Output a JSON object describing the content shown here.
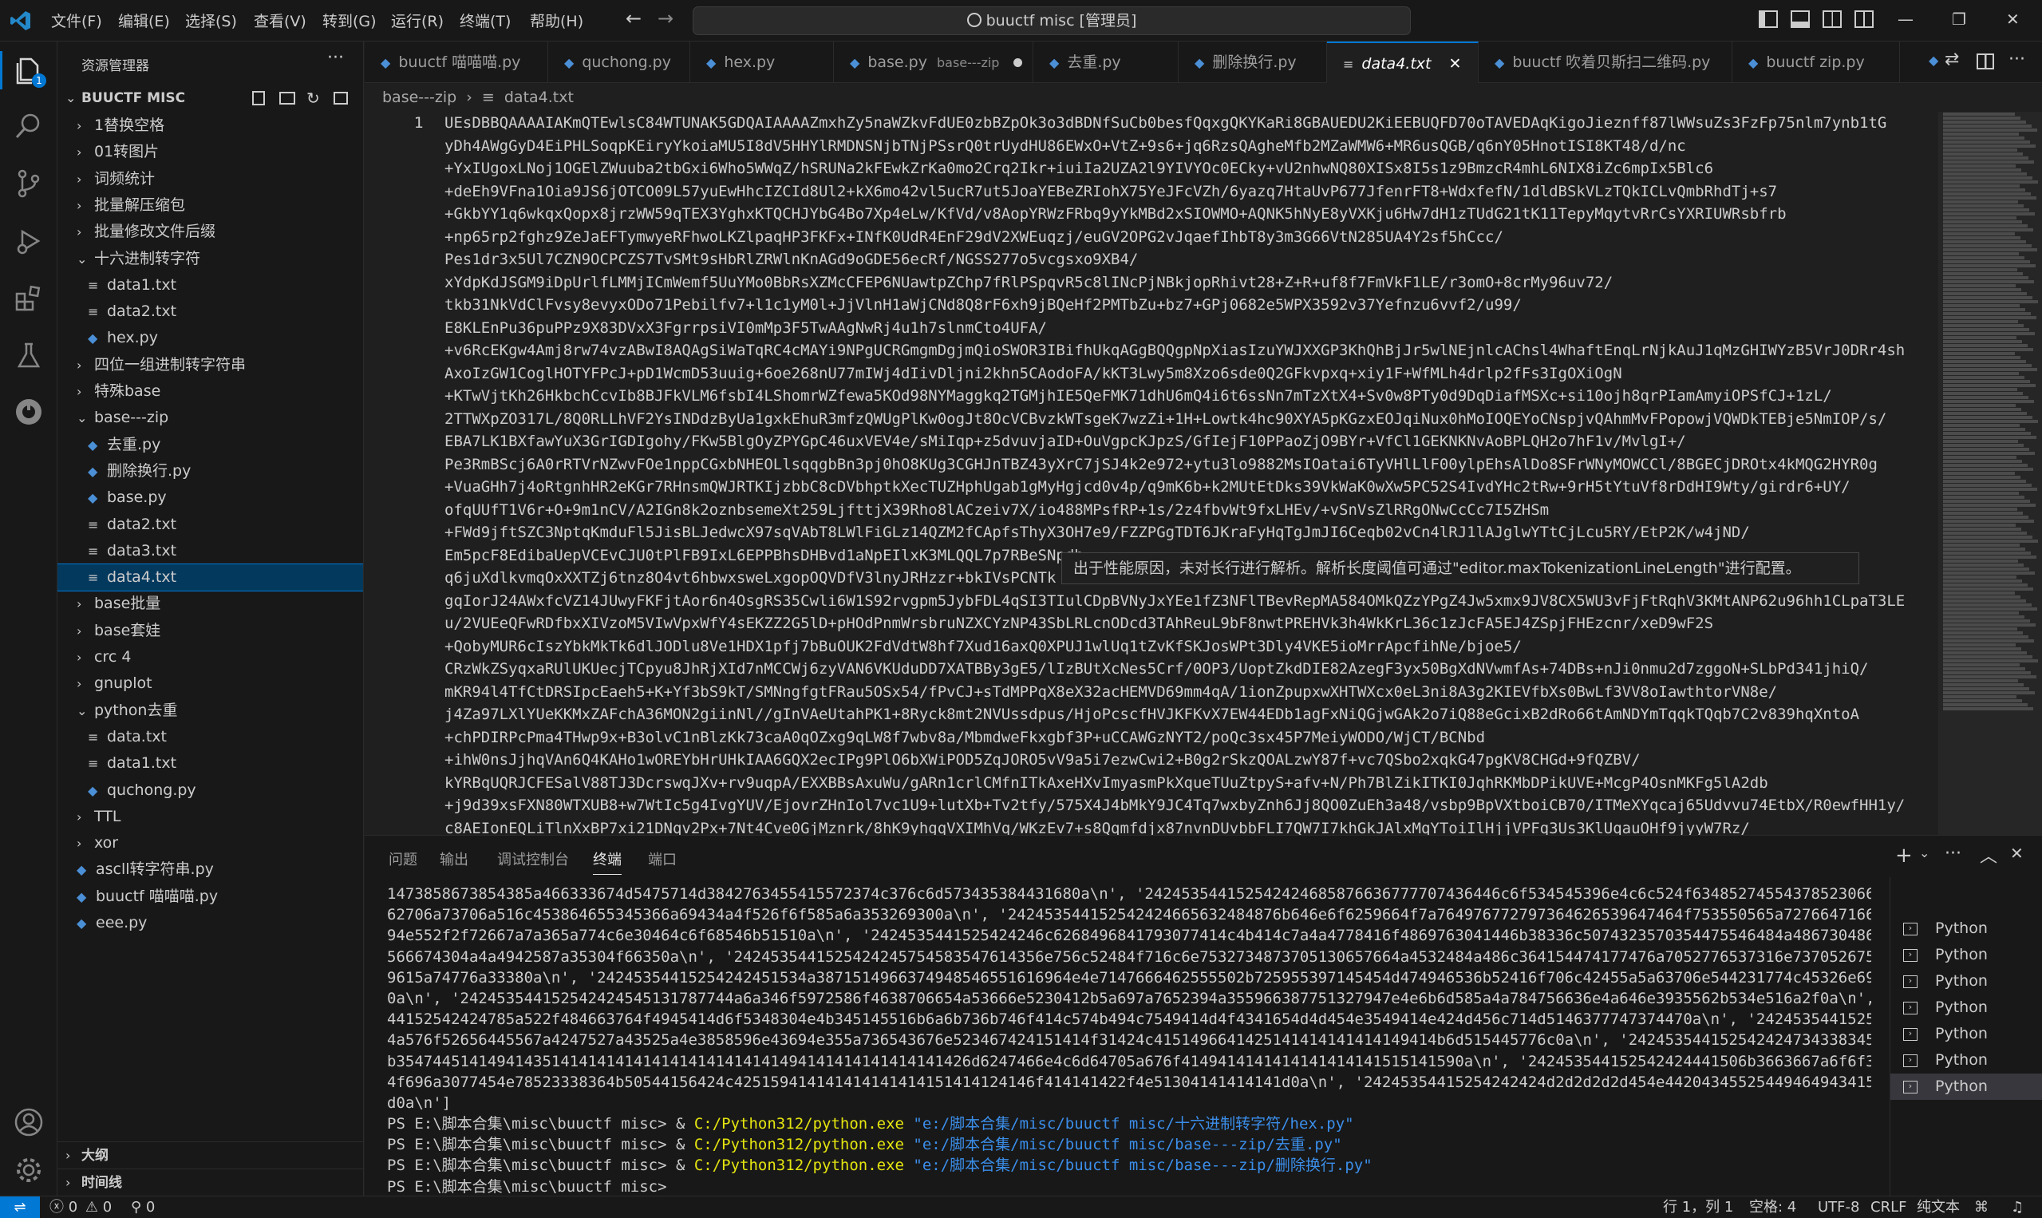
{
  "titlebar": {
    "menu": [
      "文件(F)",
      "编辑(E)",
      "选择(S)",
      "查看(V)",
      "转到(G)",
      "运行(R)",
      "终端(T)",
      "帮助(H)"
    ],
    "search_text": "buuctf misc [管理员]"
  },
  "sidebar": {
    "header": "资源管理器",
    "root": "BUUCTF MISC",
    "items": [
      {
        "label": "1替换空格",
        "kind": "folder",
        "expanded": false,
        "depth": 1
      },
      {
        "label": "01转图片",
        "kind": "folder",
        "expanded": false,
        "depth": 1
      },
      {
        "label": "词频统计",
        "kind": "folder",
        "expanded": false,
        "depth": 1
      },
      {
        "label": "批量解压缩包",
        "kind": "folder",
        "expanded": false,
        "depth": 1
      },
      {
        "label": "批量修改文件后缀",
        "kind": "folder",
        "expanded": false,
        "depth": 1
      },
      {
        "label": "十六进制转字符",
        "kind": "folder",
        "expanded": true,
        "depth": 1
      },
      {
        "label": "data1.txt",
        "kind": "txt",
        "depth": 2
      },
      {
        "label": "data2.txt",
        "kind": "txt",
        "depth": 2
      },
      {
        "label": "hex.py",
        "kind": "py",
        "depth": 2
      },
      {
        "label": "四位一组进制转字符串",
        "kind": "folder",
        "expanded": false,
        "depth": 1
      },
      {
        "label": "特殊base",
        "kind": "folder",
        "expanded": false,
        "depth": 1
      },
      {
        "label": "base---zip",
        "kind": "folder",
        "expanded": true,
        "depth": 1
      },
      {
        "label": "去重.py",
        "kind": "py",
        "depth": 2
      },
      {
        "label": "删除换行.py",
        "kind": "py",
        "depth": 2
      },
      {
        "label": "base.py",
        "kind": "py",
        "depth": 2
      },
      {
        "label": "data2.txt",
        "kind": "txt",
        "depth": 2
      },
      {
        "label": "data3.txt",
        "kind": "txt",
        "depth": 2
      },
      {
        "label": "data4.txt",
        "kind": "txt",
        "depth": 2,
        "selected": true
      },
      {
        "label": "base批量",
        "kind": "folder",
        "expanded": false,
        "depth": 1
      },
      {
        "label": "base套娃",
        "kind": "folder",
        "expanded": false,
        "depth": 1
      },
      {
        "label": "crc 4",
        "kind": "folder",
        "expanded": false,
        "depth": 1
      },
      {
        "label": "gnuplot",
        "kind": "folder",
        "expanded": false,
        "depth": 1
      },
      {
        "label": "python去重",
        "kind": "folder",
        "expanded": true,
        "depth": 1
      },
      {
        "label": "data.txt",
        "kind": "txt",
        "depth": 2
      },
      {
        "label": "data1.txt",
        "kind": "txt",
        "depth": 2
      },
      {
        "label": "quchong.py",
        "kind": "py",
        "depth": 2
      },
      {
        "label": "TTL",
        "kind": "folder",
        "expanded": false,
        "depth": 1
      },
      {
        "label": "xor",
        "kind": "folder",
        "expanded": false,
        "depth": 1
      },
      {
        "label": "ascll转字符串.py",
        "kind": "py",
        "depth": 1
      },
      {
        "label": "buuctf 喵喵喵.py",
        "kind": "py",
        "depth": 1
      },
      {
        "label": "eee.py",
        "kind": "py",
        "depth": 1
      }
    ],
    "outline": "大纲",
    "timeline": "时间线"
  },
  "tabs": [
    {
      "label": "buuctf 喵喵喵.py"
    },
    {
      "label": "quchong.py"
    },
    {
      "label": "hex.py"
    },
    {
      "label": "base.py",
      "desc": "base---zip",
      "dirty": true
    },
    {
      "label": "去重.py"
    },
    {
      "label": "删除换行.py"
    },
    {
      "label": "data4.txt",
      "active": true
    },
    {
      "label": "buuctf 吹着贝斯扫二维码.py"
    },
    {
      "label": "buuctf zip.py"
    }
  ],
  "breadcrumb": {
    "folder": "base---zip",
    "file": "data4.txt"
  },
  "editor": {
    "line_number": "1",
    "lines": [
      "UEsDBBQAAAAIAKmQTEwlsC84WTUNAK5GDQAIAAAAZmxhZy5naWZkvFdUE0zbBZpOk3o3dBDNfSuCb0besfQqxgQKYKaRi8GBAUEDU2KiEEBUQFD70oTAVEDAqKigoJieznff87lWWsuZs3FzFp75nlm7ynb1tG",
      "yDh4AWgGyD4EiPHLSoqpKEiryYkoiaMU5I8dV5HHYlRMDNSNjbTNjPSsrQ0trUydHU86EWxO+VtZ+9s6+jq6RzsQAgheMfb2MZaWMW6+MR6usQGB/q6nY05HnotISI8KT48/d/nc",
      "+YxIUgoxLNoj1OGElZWuuba2tbGxi6Who5WWqZ/hSRUNa2kFEwkZrKa0mo2Crq2Ikr+iuiIa2UZA2l9YIVYOc0ECky+vU2nhwNQ80XISx8I5s1z9BmzcR4mhL6NIX8iZc6mpIx5Blc6",
      "+deEh9VFna1Oia9JS6jOTCO09L57yuEwHhcIZCId8Ul2+kX6mo42vl5ucR7ut5JoaYEBeZRIohX75YeJFcVZh/6yazq7HtaUvP677JfenrFT8+WdxfefN/1dldBSkVLzTQkICLvQmbRhdTj+s7",
      "+GkbYY1q6wkqxQopx8jrzWW59qTEX3YghxKTQCHJYbG4Bo7Xp4eLw/KfVd/v8AopYRWzFRbq9yYkMBd2xSIOWMO+AQNK5hNyE8yVXKju6Hw7dH1zTUdG21tK11TepyMqytvRrCsYXRIUWRsbfrb",
      "+np65rp2fghz9ZeJaEFTymwyeRFhwoLKZlpaqHP3FKFx+INfK0UdR4EnF29dV2XWEuqzj/euGV2OPG2vJqaefIhbT8y3m3G66VtN285UA4Y2sf5hCcc/",
      "Pes1dr3x5Ul7CZN9OCPCZS7TvSMt9sHbRlZRWlnKnAGd9oGDE56ecRf/NGSS277o5vcgsxo9XB4/",
      "xYdpKdJSGM9iDpUrlfLMMjICmWemf5UuYMo0BbRsXZMcCFEP6NUawtpZChp7fRlPSpqvR5c8lINcPjNBkjopRhivt28+Z+R+uf8f7FmVkF1LE/r3omO+8crMy96uv72/",
      "tkb31NkVdClFvsy8evyxODo71Pebilfv7+l1c1yM0l+JjVlnH1aWjCNd8Q8rF6xh9jBQeHf2PMTbZu+bz7+GPj0682e5WPX3592v37Yefnzu6vvf2/u99/",
      "E8KLEnPu36puPPz9X83DVxX3FgrrpsiVI0mMp3F5TwAAgNwRj4u1h7slnmCto4UFA/",
      "+v6RcEKgw4Amj8rw74vzABwI8AQAgSiWaTqRC4cMAYi9NPgUCRGmgmDgjmQioSWOR3IBifhUkqAGgBQQgpNpXiasIzuYWJXXGP3KhQhBjJr5wlNEjnlcAChsl4WhaftEnqLrNjkAuJ1qMzGHIWYzB5VrJ0DRr4sh",
      "AxoIzGW1CoglHOTYFPcJ+pD1WcmD53uuig+6oe268nU77mIWj4dIivDljni2khn5CAodoFA/kKT3Lwy5m8Xzo6sde0Q2GFkvpxq+xiy1F+WfMLh4drlp2fFs3IgOXiOgN",
      "+KTwVjtKh26HkbchCcvIb8BJFkVLM6fsbI4LShomrWZfewa5KOd98NYMaggkq2TGMjhIE5QeFMK71dhU6mQ4i6t6ssNn7mTzXtX4+Sv0w8PTy0d9DqDiafMSXc+si10ojh8qrPIamAmyiOPSfCJ+1zL/",
      "2TTWXpZO317L/8Q0RLLhVF2YsINDdzByUa1gxkEhuR3mfzQWUgPlKw0ogJt8OcVCBvzkWTsgeK7wzZi+1H+Lowtk4hc90XYA5pKGzxEOJqiNux0hMoIOQEYoCNspjvQAhmMvFPopowjVQWDkTEBje5NmIOP/s/",
      "EBA7LK1BXfawYuX3GrIGDIgohy/FKw5BlgOyZPYGpC46uxVEV4e/sMiIqp+z5dvuvjaID+OuVgpcKJpzS/GfIejF10PPaoZjO9BYr+VfCl1GEKNKNvAoBPLQH2o7hF1v/MvlgI+/",
      "Pe3RmBScj6A0rRTVrNZwvFOe1nppCGxbNHEOLlsqqgbBn3pj0hO8KUg3CGHJnTBZ43yXrC7jSJ4k2e972+ytu3lo9882MsIOatai6TyVHlLlF00ylpEhsAlDo8SFrWNyMOWCCl/8BGECjDROtx4kMQG2HYR0g",
      "+VuaGHh7j4oRtgnhHR2eKGr7RHnsmQWJRTKIjzbbC8cDVbhptkXecTUZHphUgab1gMyHgjcd0v4p/q9mK6b+k2MUtEtDks39VkWaK0wXw5PC52S4IvdYHc2tRw+9rH5tYtuVf8rDdHI9Wty/girdr6+UY/",
      "ofqUUfT1V6r+O+9m1nCV/A2IGn8k2oznbsemeXt259LjfttjX39Rho8lACzeiv7X/io488MPsfRP+1s/2z4fbvWt9fxLHEv/+vSnVsZlRRgONwCcCc7I5ZHSm",
      "+FWd9jftSZC3NptqKmduFl5JisBLJedwcX97sqVAbT8LWlFiGLz14QZM2fCApfsThyX3OH7e9/FZZPGgTDT6JKraFyHqTgJmJI6Ceqb02vCn4lRJ1lAJglwYTtCjLcu5RY/EtP2K/w4jND/",
      "Em5pcF8EdibaUepVCEvCJU0tPlFB9IxL6EPPBhsDHBvd1aNpEIlxK3MLQQL7p7RBeSNpdh==============================",
      "q6juXdlkvmqOxXXTZj6tnz8O4vt6hbwxsweLxgopOQVDfV3lnyJRHzzr+bkIVsPCNTk",
      "gqIorJ24AWxfcVZ14JUwyFKFjtAor6n4OsgRS35Cwli6W1S92rvgpm5JybFDL4qSI3TIulCDpBVNyJxYEe1fZ3NFlTBevRepMA584OMkQZzYPgZ4Jw5xmx9JV8CX5WU3vFjFtRqhV3KMtANP62u96hh1CLpaT3LE",
      "u/2VUEeQFwRDfbxXIVzoM5VIwVpxWfY4sEKZZ2G5lD+pHOdPnmWrsbruNZXCYzNP43SbLRLcnODcd3TAhReuL9bF8nwtPREHVk3h4WkKrL36c1zJcFA5EJ4ZSpjFHEzcnr/xeD9wF2S",
      "+QobyMUR6cIszYbkMkTk6dlJODlu8Ve1HDX1pfj7bBuOUK2FdVdtW8hf7Xud16axQ0XPUJ1wlUq1tZvKfSKJosWPt3Dly4VKE5ioMrrApcfihNe/bjoe5/",
      "CRzWkZSyqxaRUlUKUecjTCpyu8JhRjXId7nMCCWj6zyVAN6VKUduDD7XATBBy3gE5/lIzBUtXcNes5Crf/0OP3/UoptZkdDIE82AzegF3yx50BgXdNVwmfAs+74DBs+nJi0nmu2d7zggoN+SLbPd341jhiQ/",
      "mKR94l4TfCtDRSIpcEaeh5+K+Yf3bS9kT/SMNngfgtFRau5OSx54/fPvCJ+sTdMPPqX8eX32acHEMVD69mm4qA/1ionZpupxwXHTWXcx0eL3ni8A3g2KIEVfbXs0BwLf3VV8oIawthtorVN8e/",
      "j4Za97LXlYUeKKMxZAFchA36MON2giinNl//gInVAeUtahPK1+8Ryck8mt2NVUssdpus/HjoPcscfHVJKFKvX7EW44EDb1agFxNiQGjwGAk2o7iQ88eGcixB2dRo66tAmNDYmTqqkTQqb7C2v839hqXntoA",
      "+chPDIRPcPma4THwp9x+B3olvC1nBlzKk73caA0qOZxg9qLW8f7wbv8a/MbmdweFkxgbf3P+uCCAWGzNYT2/poQc3sx45P7MeiyWODO/WjCT/BCNbd",
      "+ihW0nsJjhqVAn6Q4KAHo1wOREYbHrUHkIAA6GQX2ecIPg9PlO6bXWiPOD5ZqJORO5vV9a5i7ezwCwi2+B0g2rSkzQOALzwY87f+vc7QSbo2xqkG47pgKV8CHGd+9fQZBV/",
      "kYRBqUQRJCFESalV88TJ3DcrswqJXv+rv9uqpA/EXXBBsAxuWu/gARn1crlCMfnITkAxeHXvImyasmPkXqueTUuZtpyS+afv+N/Ph7BlZikITKI0JqhRKMbDPikUVE+McgP4OsnMKFg5lA2db",
      "+j9d39xsFXN80WTXUB8+w7WtIc5g4IvgYUV/EjovrZHnIol7vc1U9+lutXb+Tv2tfy/575X4J4bMkY9JC4Tq7wxbyZnh6Jj8QO0ZuEh3a48/vsbp9BpVXtboiCB70/ITMeXYqcaj65Udvvu74EtbX/R0ewfHH1y/",
      "c8AEIonEQLiTlnXxBP7xi21DNqv2Px+7Nt4Cve0GjMznrk/8hK9yhgqVXIMhVq/WKzEv7+s8Qqmfdjx87nvnDUvbbFLI7QW7I7khGkJAlxMqYToiIlHjjVPFq3Us3KlUqauOHf9jyyW7Rz/"
    ],
    "perf_message": "出于性能原因，未对长行进行解析。解析长度阈值可通过\"editor.maxTokenizationLineLength\"进行配置。"
  },
  "panel": {
    "tabs": [
      "问题",
      "输出",
      "调试控制台",
      "终端",
      "端口"
    ],
    "active_tab": "终端",
    "terminal_lines": [
      "1473858673854385a466333674d5475714d3842763455415572374c376c6d573435384431680a\\n', '242453544152542424685876636777707436446c6f534545396e4c6c524f63485274554378523066617949",
      "62706a73706a516c453864655345366a69434a4f526f6f585a6a353269300a\\n', '242453544152542424665632484876b646e6f6259664f7a764976772797364626539647464f753550565a7276647166316b623",
      "94e552f2f72667a7a365a774c6e30464c6f68546b51510a\\n', '2424535441525424246c6268496841793077414c4b414c7a4a4778416f4869763041446b38336c5074323570354475546484a486730486f5a42",
      "566674304a4a4942587a35304f66350a\\n', '2424535441525424245754583547614356e756c52484f716c6e7532734873705130657664a4532484a486c364154474177476a7052776537316e7370526752414f4",
      "9615a74776a33380a\\n', '24245354415254242451534a3871514966374948546551616964e4e7147666462555502b725955397145454d474946536b52416f706c42455a5a63706e544231774c45326e694a5a45",
      "0a\\n', '242453544152542424545131787744a6a346f5972586f4638706654a53666e5230412b5a697a7652394a355966387751327947e4e6b6d585a4a784756636e4a646e3935562b534e516a2f0a\\n', '24245354",
      "44152542424785a522f484663764f4945414d6f5348304e4b345145516b6a6b736b746f414c574b494c7549414d4f4341654d4d454e3549414e424d456c714d5146377747374470a\\n', '24245354415254242446e71",
      "4a576f52656445567a4247527a43525a4e3858596e43694e355a736543676e523467424151414f31424c4151496641425141414141414149414b6d515445776c0a\\n', '2424535441525424247343383457545544e14",
      "b354744514149414351414141414141414141414141494141414141414141426d6247466e4c6d64705a676f4149414141414141414141515141590a\\n', '242453544152542424441506b3663667a6f6f394d42664a787a2",
      "4f696a3077454e78523338364b50544156424c425159414141414141414151414124146f414141422f4e51304141414141d0a\\n', '24245354415254242424d2d2d2d2d454e44204345525449464943415354452d2",
      "d0a\\n']",
      "PS E:\\脚本合集\\misc\\buuctf misc> & C:/Python312/python.exe \"e:/脚本合集/misc/buuctf misc/十六进制转字符/hex.py\"",
      "PS E:\\脚本合集\\misc\\buuctf misc> & C:/Python312/python.exe \"e:/脚本合集/misc/buuctf misc/base---zip/去重.py\"",
      "PS E:\\脚本合集\\misc\\buuctf misc> & C:/Python312/python.exe \"e:/脚本合集/misc/buuctf misc/base---zip/删除换行.py\"",
      "PS E:\\脚本合集\\misc\\buuctf misc> "
    ],
    "command_prompt": "PS E:\\脚本合集\\misc\\buuctf misc> & ",
    "command_exe": "C:/Python312/python.exe",
    "terminals": [
      "Python",
      "Python",
      "Python",
      "Python",
      "Python",
      "Python",
      "Python"
    ]
  },
  "statusbar": {
    "errors": "0",
    "warnings": "0",
    "ports": "0",
    "position": "行 1，列 1",
    "spaces": "空格: 4",
    "encoding": "UTF-8",
    "eol": "CRLF",
    "language": "纯文本"
  },
  "colors": {
    "accent": "#0078d4",
    "folder_icon": "#c5c5c5",
    "python_icon": "#4b8fd6",
    "exe_yellow": "#e5e510",
    "string_blue": "#3b8eea"
  }
}
